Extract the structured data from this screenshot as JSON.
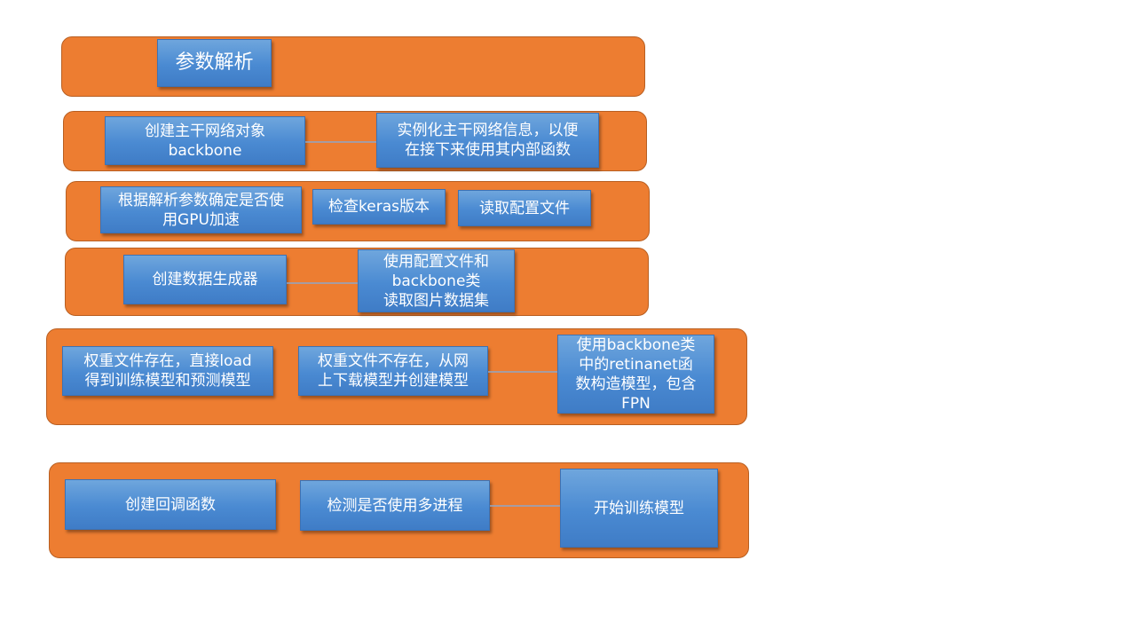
{
  "rows": [
    {
      "boxes": [
        "参数解析"
      ]
    },
    {
      "boxes": [
        "创建主干网络对象\nbackbone",
        "实例化主干网络信息，以便\n在接下来使用其内部函数"
      ]
    },
    {
      "boxes": [
        "根据解析参数确定是否使\n用GPU加速",
        "检查keras版本",
        "读取配置文件"
      ]
    },
    {
      "boxes": [
        "创建数据生成器",
        "使用配置文件和\nbackbone类\n读取图片数据集"
      ]
    },
    {
      "boxes": [
        "权重文件存在，直接load\n得到训练模型和预测模型",
        "权重文件不存在，从网\n上下载模型并创建模型",
        "使用backbone类\n中的retinanet函\n数构造模型，包含\nFPN"
      ]
    },
    {
      "boxes": [
        "创建回调函数",
        "检测是否使用多进程",
        "开始训练模型"
      ]
    }
  ],
  "colors": {
    "band": "#ED7D31",
    "box": "#4A8AD2",
    "connector": "#8EA7C7"
  }
}
